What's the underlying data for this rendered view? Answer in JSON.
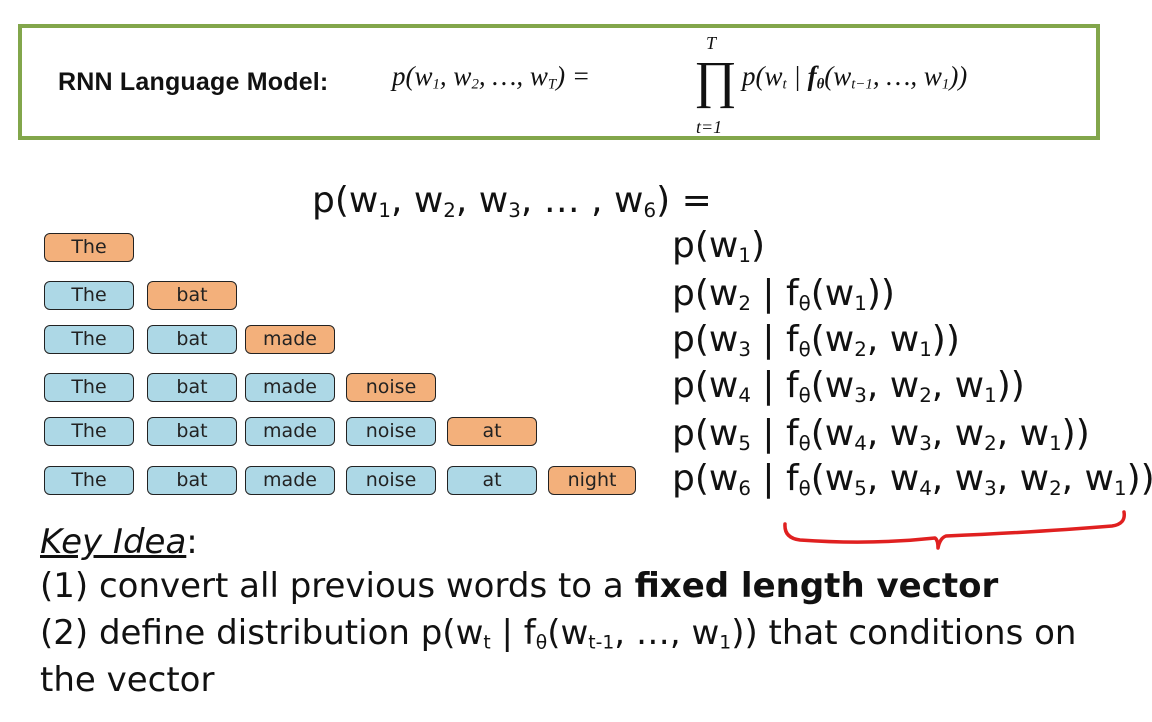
{
  "header": {
    "label": "RNN Language Model:",
    "formula_lhs": "p(w₁, w₂, …, w_T) =",
    "prod_upper": "T",
    "prod_lower": "t=1",
    "formula_rhs": "p(w_t | f_θ(w_{t−1}, …, w₁))"
  },
  "title_eq": "p(w₁, w₂, w₃, … , w₆) =",
  "rows": [
    {
      "words": [
        "The"
      ],
      "highlight": 0,
      "prob": "p(w₁)"
    },
    {
      "words": [
        "The",
        "bat"
      ],
      "highlight": 1,
      "prob": "p(w₂ | fθ(w₁))"
    },
    {
      "words": [
        "The",
        "bat",
        "made"
      ],
      "highlight": 2,
      "prob": "p(w₃ | fθ(w₂, w₁))"
    },
    {
      "words": [
        "The",
        "bat",
        "made",
        "noise"
      ],
      "highlight": 3,
      "prob": "p(w₄ | fθ(w₃, w₂, w₁))"
    },
    {
      "words": [
        "The",
        "bat",
        "made",
        "noise",
        "at"
      ],
      "highlight": 4,
      "prob": "p(w₅ | fθ(w₄, w₃, w₂, w₁))"
    },
    {
      "words": [
        "The",
        "bat",
        "made",
        "noise",
        "at",
        "night"
      ],
      "highlight": 5,
      "prob": "p(w₆ | fθ(w₅, w₄, w₃, w₂, w₁))"
    }
  ],
  "key_idea": {
    "title": "Key Idea",
    "colon": ":",
    "line1_pre": "(1) convert all previous words to a ",
    "line1_bold": "fixed length vector",
    "line2": "(2) define distribution p(wt | fθ(wt-1, …, w1)) that conditions on",
    "line3": "the vector"
  },
  "colors": {
    "box_border": "#82a64b",
    "context_word": "#add8e6",
    "target_word": "#f3b07b",
    "brace": "#e02020"
  }
}
